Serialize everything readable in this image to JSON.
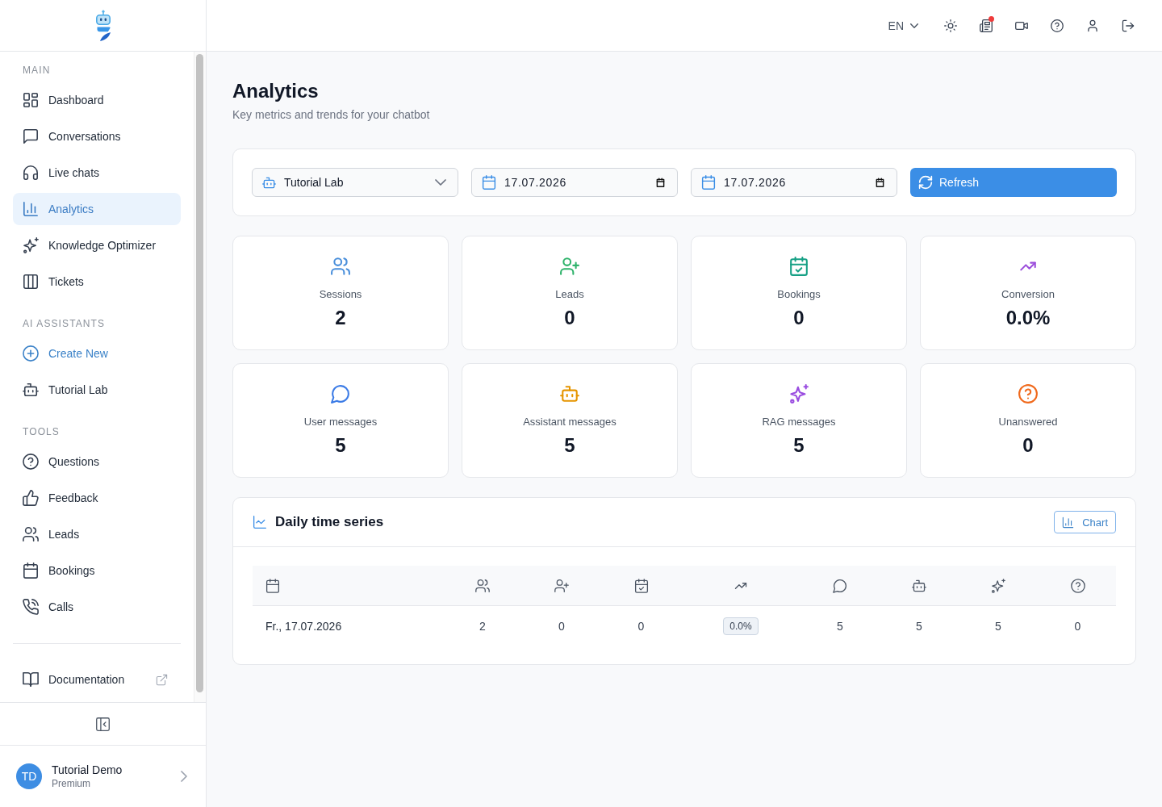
{
  "sidebar": {
    "sections": [
      {
        "heading": "MAIN",
        "items": [
          {
            "label": "Dashboard",
            "selected": false
          },
          {
            "label": "Conversations",
            "selected": false
          },
          {
            "label": "Live chats",
            "selected": false
          },
          {
            "label": "Analytics",
            "selected": true
          },
          {
            "label": "Knowledge Optimizer",
            "selected": false
          },
          {
            "label": "Tickets",
            "selected": false
          }
        ]
      },
      {
        "heading": "AI ASSISTANTS",
        "items": [
          {
            "label": "Create New",
            "kind": "action",
            "selected": false
          },
          {
            "label": "Tutorial Lab",
            "kind": "link",
            "selected": false
          }
        ]
      },
      {
        "heading": "TOOLS",
        "items": [
          {
            "label": "Questions",
            "selected": false
          },
          {
            "label": "Feedback",
            "selected": false
          },
          {
            "label": "Leads",
            "selected": false
          },
          {
            "label": "Bookings",
            "selected": false
          },
          {
            "label": "Calls",
            "selected": false
          }
        ]
      }
    ],
    "documentation_link": {
      "label": "Documentation"
    },
    "user": {
      "initials": "TD",
      "name": "Tutorial Demo",
      "plan": "Premium"
    }
  },
  "header": {
    "language": "EN",
    "news_unread": true
  },
  "page": {
    "title": "Analytics",
    "subtitle": "Key metrics and trends for your chatbot"
  },
  "filters": {
    "assistant": "Tutorial Lab",
    "date_from": "17.07.2026",
    "date_to": "17.07.2026",
    "refresh_button": "Refresh"
  },
  "stats": [
    {
      "label": "Sessions",
      "value": "2",
      "color": "#4a8fdb"
    },
    {
      "label": "Leads",
      "value": "0",
      "color": "#2fb36b"
    },
    {
      "label": "Bookings",
      "value": "0",
      "color": "#16a085"
    },
    {
      "label": "Conversion",
      "value": "0.0%",
      "color": "#9b4ddb"
    },
    {
      "label": "User messages",
      "value": "5",
      "color": "#3b7be6"
    },
    {
      "label": "Assistant messages",
      "value": "5",
      "color": "#e69500"
    },
    {
      "label": "RAG messages",
      "value": "5",
      "color": "#9a4de0"
    },
    {
      "label": "Unanswered",
      "value": "0",
      "color": "#f06a1d"
    }
  ],
  "time_series": {
    "title": "Daily time series",
    "view_button": "Chart",
    "rows": [
      {
        "date": "Fr., 17.07.2026",
        "cells": [
          {
            "kind": "number",
            "value": "2"
          },
          {
            "kind": "number",
            "value": "0"
          },
          {
            "kind": "number",
            "value": "0"
          },
          {
            "kind": "badge",
            "value": "0.0%"
          },
          {
            "kind": "number",
            "value": "5"
          },
          {
            "kind": "number",
            "value": "5"
          },
          {
            "kind": "number",
            "value": "5"
          },
          {
            "kind": "number",
            "value": "0"
          }
        ]
      }
    ]
  }
}
